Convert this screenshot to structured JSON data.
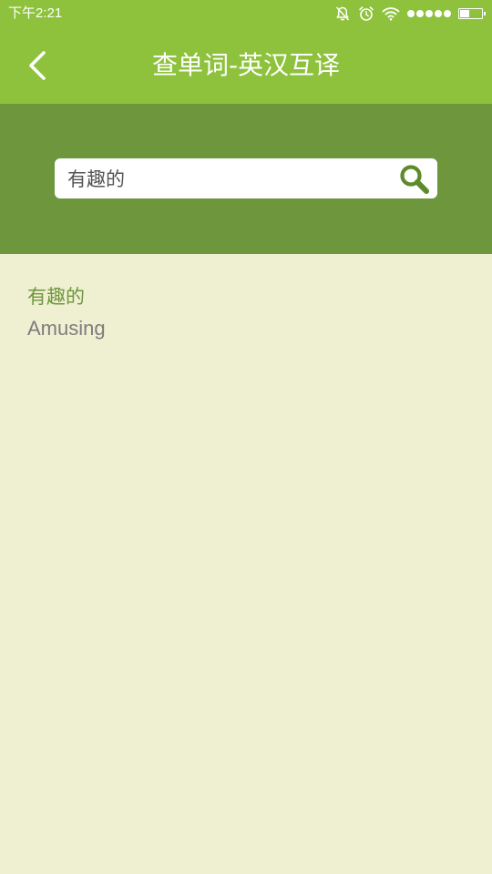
{
  "status_bar": {
    "time": "下午2:21",
    "icons": [
      "alarm-off-icon",
      "alarm-clock-icon",
      "wifi-icon",
      "signal-icon",
      "battery-icon"
    ],
    "battery_level": 0.45
  },
  "app_bar": {
    "back_icon": "chevron-left-icon",
    "title": "查单词-英汉互译"
  },
  "search": {
    "value": "有趣的",
    "icon": "search-icon"
  },
  "result": {
    "word": "有趣的",
    "translation": "Amusing"
  },
  "colors": {
    "app_bar": "#8ec23c",
    "search_panel": "#6e963d",
    "background": "#eff0d2",
    "accent_text": "#6e963d",
    "secondary_text": "#7c7c7c"
  }
}
